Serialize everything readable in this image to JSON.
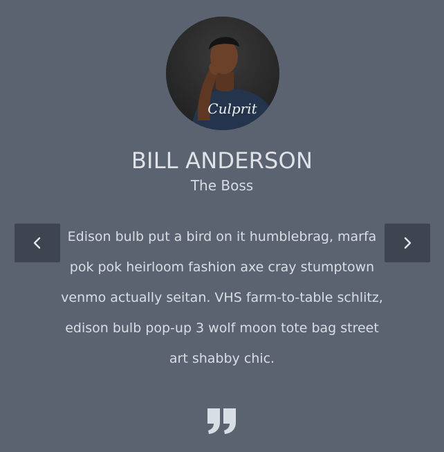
{
  "profile": {
    "name": "BILL ANDERSON",
    "role": "The Boss",
    "shirt_text": "Culprit",
    "avatar_icon": "person-portrait"
  },
  "testimonial": {
    "text": "Edison bulb put a bird on it humblebrag, marfa pok pok heirloom fashion axe cray stumptown venmo actually seitan. VHS farm-to-table schlitz, edison bulb pop-up 3 wolf moon tote bag street art shabby chic."
  },
  "navigation": {
    "prev_icon": "chevron-left-icon",
    "next_icon": "chevron-right-icon"
  },
  "colors": {
    "background": "#5b6270",
    "button": "#3f4550",
    "text": "#dfe3e8",
    "quote_mark": "#d9dee4"
  }
}
